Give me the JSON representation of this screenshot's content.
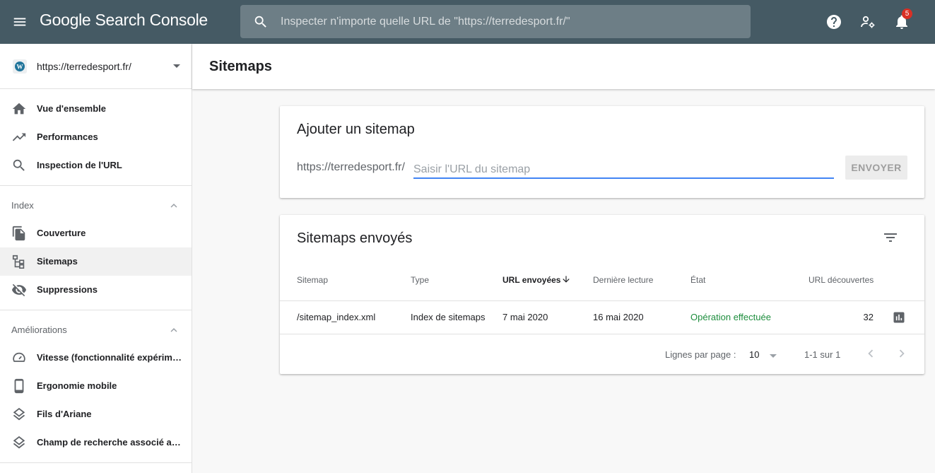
{
  "app": {
    "brand": "Google Search Console"
  },
  "search": {
    "placeholder": "Inspecter n'importe quelle URL de \"https://terredesport.fr/\""
  },
  "notifications": {
    "count": "5"
  },
  "property": {
    "url": "https://terredesport.fr/"
  },
  "sidebar": {
    "top_items": [
      {
        "label": "Vue d'ensemble",
        "icon": "home-icon"
      },
      {
        "label": "Performances",
        "icon": "trending-up-icon"
      },
      {
        "label": "Inspection de l'URL",
        "icon": "search-icon"
      }
    ],
    "index": {
      "label": "Index",
      "items": [
        {
          "label": "Couverture",
          "icon": "copy-icon"
        },
        {
          "label": "Sitemaps",
          "icon": "sitemap-icon",
          "active": true
        },
        {
          "label": "Suppressions",
          "icon": "visibility-off-icon"
        }
      ]
    },
    "ameliorations": {
      "label": "Améliorations",
      "items": [
        {
          "label": "Vitesse (fonctionnalité expérimentale)",
          "icon": "speed-icon"
        },
        {
          "label": "Ergonomie mobile",
          "icon": "phone-icon"
        },
        {
          "label": "Fils d'Ariane",
          "icon": "layers-icon"
        },
        {
          "label": "Champ de recherche associé aux liens sitelinks",
          "icon": "layers-icon"
        }
      ]
    }
  },
  "page": {
    "title": "Sitemaps"
  },
  "add_sitemap": {
    "title": "Ajouter un sitemap",
    "prefix": "https://terredesport.fr/",
    "placeholder": "Saisir l'URL du sitemap",
    "submit_label": "ENVOYER"
  },
  "submitted": {
    "title": "Sitemaps envoyés",
    "columns": [
      "Sitemap",
      "Type",
      "URL envoyées",
      "Dernière lecture",
      "État",
      "URL découvertes"
    ],
    "sorted_column": "URL envoyées",
    "rows": [
      {
        "sitemap": "/sitemap_index.xml",
        "type": "Index de sitemaps",
        "submitted": "7 mai 2020",
        "last_read": "16 mai 2020",
        "status": "Opération effectuée",
        "discovered": "32"
      }
    ],
    "pagination": {
      "rows_per_page_label": "Lignes par page :",
      "rows_per_page": "10",
      "range": "1-1 sur 1"
    }
  },
  "colors": {
    "topbar": "#455a64",
    "accent": "#4285f4",
    "success": "#1e8e3e",
    "badge": "#d93025"
  }
}
